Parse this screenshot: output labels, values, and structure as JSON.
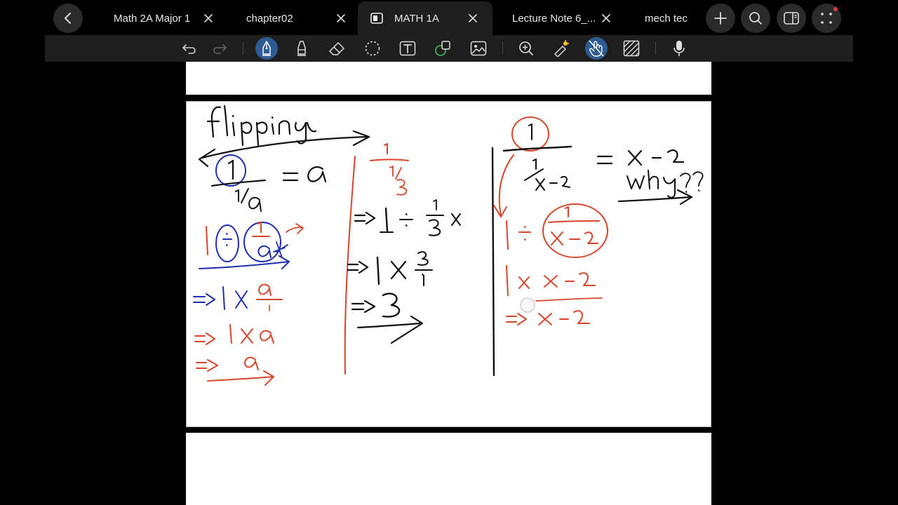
{
  "tabs": [
    {
      "label": "Math 2A  Major 1",
      "active": false
    },
    {
      "label": "chapter02",
      "active": false
    },
    {
      "label": "MATH 1A",
      "active": true
    },
    {
      "label": "Lecture Note 6_...",
      "active": false
    },
    {
      "label": "mech tec",
      "active": false
    }
  ],
  "toolbar": {
    "tools": [
      "undo-icon",
      "redo-icon",
      "pen-icon",
      "highlighter-icon",
      "eraser-icon",
      "lasso-icon",
      "text-icon",
      "shapes-icon",
      "image-icon",
      "zoom-icon",
      "laser-icon",
      "hand-touch-icon",
      "pattern-icon",
      "microphone-icon"
    ],
    "selected": [
      "pen-icon",
      "hand-touch-icon"
    ]
  },
  "note": {
    "title_ink": "flipping",
    "left_column": [
      "1/(1/a) = a",
      "1 ÷ 1/a",
      "=> 1 x a/1",
      "=> 1 x a",
      "=> a"
    ],
    "middle_column": [
      "1/(1/3)",
      "=> 1 ÷ 1/3",
      "=> 1 x 3/1",
      "=> 3"
    ],
    "right_column": [
      "1/(1/(x-2)) = x-2",
      "why??",
      "1 ÷ 1/(x-2)",
      "1 x x-2",
      "=> x-2"
    ]
  },
  "colors": {
    "ink_black": "#111111",
    "ink_red": "#d9452b",
    "ink_blue": "#1f2fb0",
    "accent": "#2f5b93"
  }
}
